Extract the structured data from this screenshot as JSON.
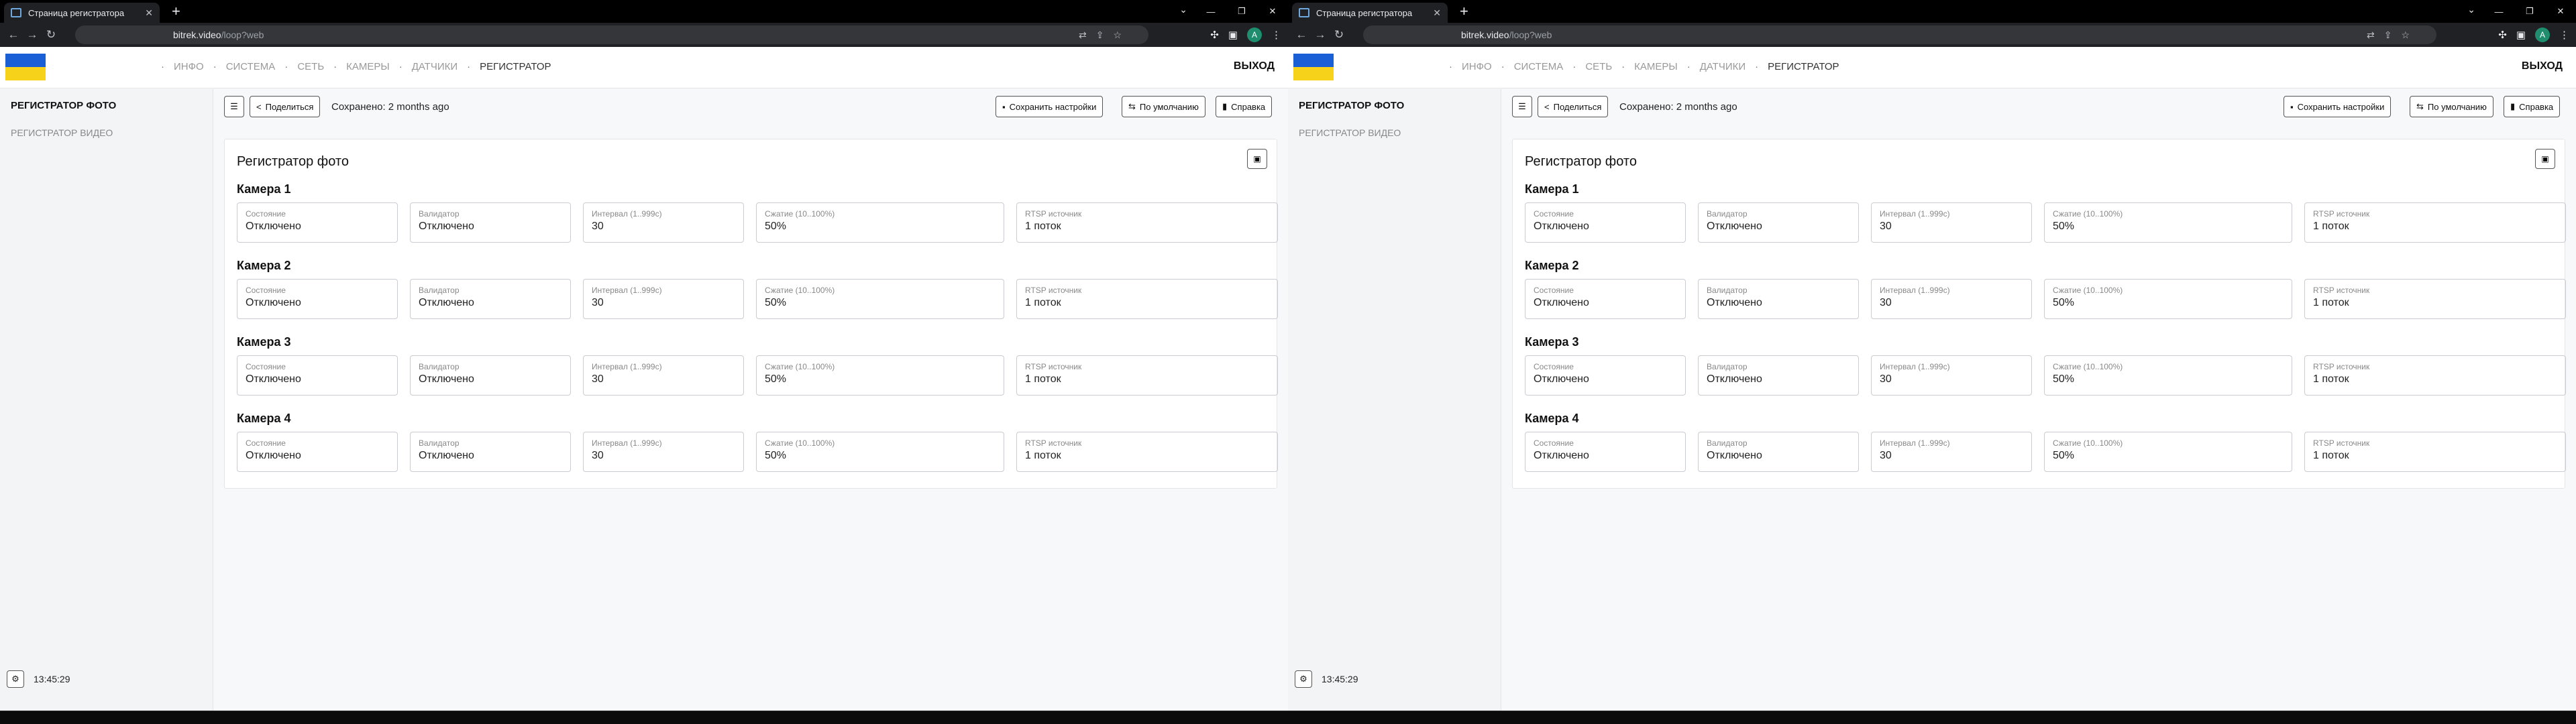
{
  "browser": {
    "tab_title": "Страница регистратора",
    "tab_close": "✕",
    "new_tab": "+",
    "url_host": "bitrek.video",
    "url_path": "/loop?web",
    "avatar_letter": "A"
  },
  "header": {
    "nav": [
      "ИНФО",
      "СИСТЕМА",
      "СЕТЬ",
      "КАМЕРЫ",
      "ДАТЧИКИ",
      "РЕГИСТРАТОР"
    ],
    "separator": "·",
    "logout": "ВЫХОД",
    "flag_colors": {
      "top": "#1a5fd6",
      "bottom": "#f7d21a"
    }
  },
  "sidebar": {
    "items": [
      "РЕГИСТРАТОР ФОТО",
      "РЕГИСТРАТОР ВИДЕО"
    ],
    "time": "13:45:29"
  },
  "actions": {
    "share": "Поделиться",
    "saved": "Сохранено: 2 months ago",
    "save_settings": "Сохранить настройки",
    "defaults": "По умолчанию",
    "help": "Справка"
  },
  "card": {
    "title": "Регистратор фото",
    "field_labels": [
      "Состояние",
      "Валидатор",
      "Интервал (1..999с)",
      "Сжатие (10..100%)",
      "RTSP источник"
    ],
    "cameras": [
      {
        "title": "Камера 1",
        "values": [
          "Отключено",
          "Отключено",
          "30",
          "50%",
          "1 поток"
        ]
      },
      {
        "title": "Камера 2",
        "values": [
          "Отключено",
          "Отключено",
          "30",
          "50%",
          "1 поток"
        ]
      },
      {
        "title": "Камера 3",
        "values": [
          "Отключено",
          "Отключено",
          "30",
          "50%",
          "1 поток"
        ]
      },
      {
        "title": "Камера 4",
        "values": [
          "Отключено",
          "Отключено",
          "30",
          "50%",
          "1 поток"
        ]
      }
    ]
  }
}
